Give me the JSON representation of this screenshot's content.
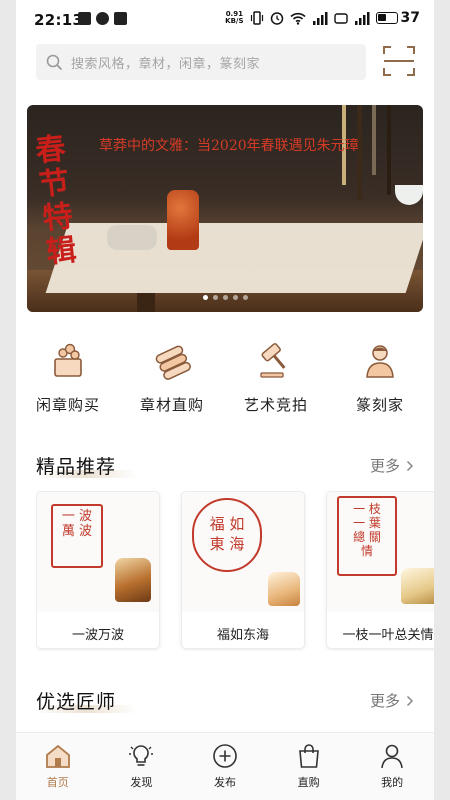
{
  "status_bar": {
    "time": "22:13",
    "speed_top": "0.91",
    "speed_unit": "KB/S",
    "battery": "37"
  },
  "search": {
    "placeholder": "搜索风格，章材，闲章，篆刻家"
  },
  "banner": {
    "title": "草莽中的文雅：当2020年春联遇见朱元璋",
    "vertical_text": "春节特辑",
    "slides": 5,
    "active_slide": 1
  },
  "categories": [
    {
      "label": "闲章购买",
      "icon": "seal-purchase-icon"
    },
    {
      "label": "章材直购",
      "icon": "stone-material-icon"
    },
    {
      "label": "艺术竞拍",
      "icon": "auction-gavel-icon"
    },
    {
      "label": "篆刻家",
      "icon": "carver-person-icon"
    }
  ],
  "recommend": {
    "title": "精品推荐",
    "more": "更多",
    "items": [
      {
        "name": "一波万波",
        "seal_text": "一波万波"
      },
      {
        "name": "福如东海",
        "seal_text": "福如东海"
      },
      {
        "name": "一枝一叶总关情",
        "seal_text": "一枝一叶总关情"
      }
    ]
  },
  "masters": {
    "title": "优选匠师",
    "more": "更多"
  },
  "nav": [
    {
      "label": "首页",
      "icon": "home-icon",
      "active": true
    },
    {
      "label": "发现",
      "icon": "lightbulb-icon",
      "active": false
    },
    {
      "label": "发布",
      "icon": "plus-circle-icon",
      "active": false
    },
    {
      "label": "直购",
      "icon": "shopping-bag-icon",
      "active": false
    },
    {
      "label": "我的",
      "icon": "profile-icon",
      "active": false
    }
  ],
  "colors": {
    "accent": "#b07b4c",
    "seal_red": "#c23a2c"
  }
}
